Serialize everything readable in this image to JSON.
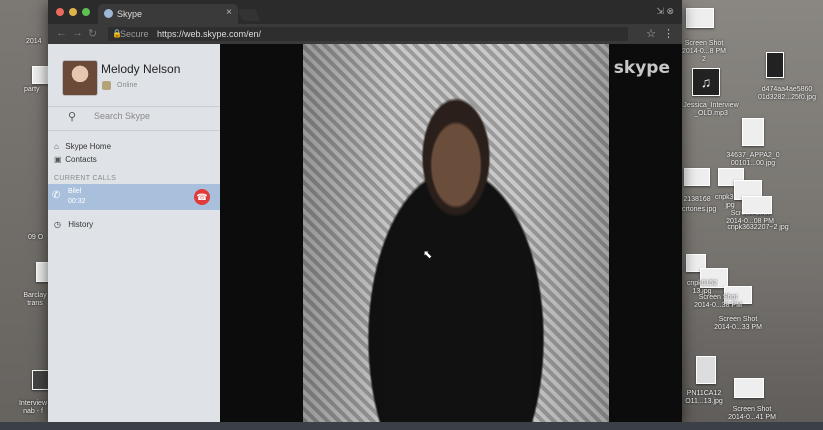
{
  "browser": {
    "tab_title": "Skype",
    "tab_close": "×",
    "url_secure": "Secure",
    "url_full": "https://web.skype.com/en/",
    "window_icons": "⇲ ⊗"
  },
  "profile": {
    "name": "Melody Nelson",
    "status": "Online"
  },
  "search": {
    "placeholder": "Search Skype"
  },
  "nav": {
    "home": "Skype Home",
    "contacts": "Contacts",
    "history": "History"
  },
  "current_calls": {
    "label": "CURRENT CALLS",
    "name": "Bilel",
    "duration": "00:32"
  },
  "video": {
    "logo": "skype"
  },
  "desktop": {
    "left_labels": [
      "2014",
      "party",
      "09 O",
      "Barclay trans",
      "Interview nab - f"
    ],
    "right_labels": [
      "Screen Shot 2014-0...8 PM 2",
      "d474aa4ae5860 01d3282...25f0.jpg",
      "Jessica_Interview _OLD.mp3",
      "34637_APPA2_0 00101...00.jpg",
      "2138168",
      "crtones.jpg",
      "cnpk3632 jpg",
      "Screen Shot 2014-0...08 PM",
      "cnpk3632207~2 jpg",
      "cnpk0152 13.jpg",
      "Screen Shot 2014-0...38 PM",
      "Screen Shot 2014-0...33 PM",
      "PN11CA12 O11...13.jpg",
      "Screen Shot 2014-0...41 PM"
    ]
  },
  "colors": {
    "sidebar_bg": "#dfe3e8",
    "active_call_bg": "#a9c0dc",
    "hangup_red": "#e03a3a",
    "status_badge": "#b2a37a"
  }
}
